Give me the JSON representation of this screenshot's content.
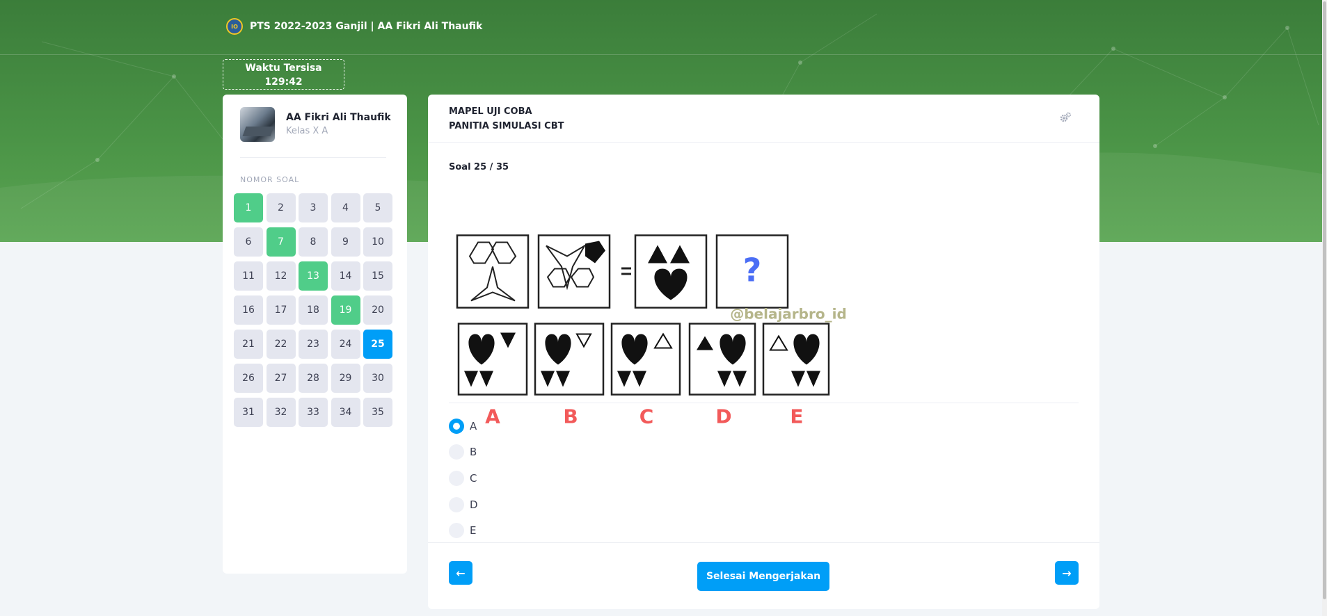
{
  "header": {
    "title": "PTS 2022-2023 Ganjil | AA Fikri Ali Thaufik",
    "timer_label": "Waktu Tersisa",
    "timer_value": "129:42"
  },
  "student": {
    "name": "AA Fikri Ali Thaufik",
    "class": "Kelas X A"
  },
  "question_nav": {
    "label": "NOMOR SOAL",
    "numbers": [
      "1",
      "2",
      "3",
      "4",
      "5",
      "6",
      "7",
      "8",
      "9",
      "10",
      "11",
      "12",
      "13",
      "14",
      "15",
      "16",
      "17",
      "18",
      "19",
      "20",
      "21",
      "22",
      "23",
      "24",
      "25",
      "26",
      "27",
      "28",
      "29",
      "30",
      "31",
      "32",
      "33",
      "34",
      "35"
    ],
    "answered": [
      1,
      7,
      13,
      19
    ],
    "current": 25
  },
  "exam": {
    "subject": "MAPEL UJI COBA",
    "committee": "PANITIA SIMULASI CBT",
    "question_counter": "Soal 25 / 35"
  },
  "question_image": {
    "watermark": "@belajarbro_id",
    "question_mark": "?",
    "choice_letters": [
      "A",
      "B",
      "C",
      "D",
      "E"
    ]
  },
  "options": [
    {
      "label": "A",
      "selected": true
    },
    {
      "label": "B",
      "selected": false
    },
    {
      "label": "C",
      "selected": false
    },
    {
      "label": "D",
      "selected": false
    },
    {
      "label": "E",
      "selected": false
    }
  ],
  "footer": {
    "prev_label": "←",
    "next_label": "→",
    "finish_label": "Selesai Mengerjakan"
  },
  "colors": {
    "primary": "#009ef7",
    "answered": "#50cd89",
    "hero_green": "#4a9346"
  }
}
